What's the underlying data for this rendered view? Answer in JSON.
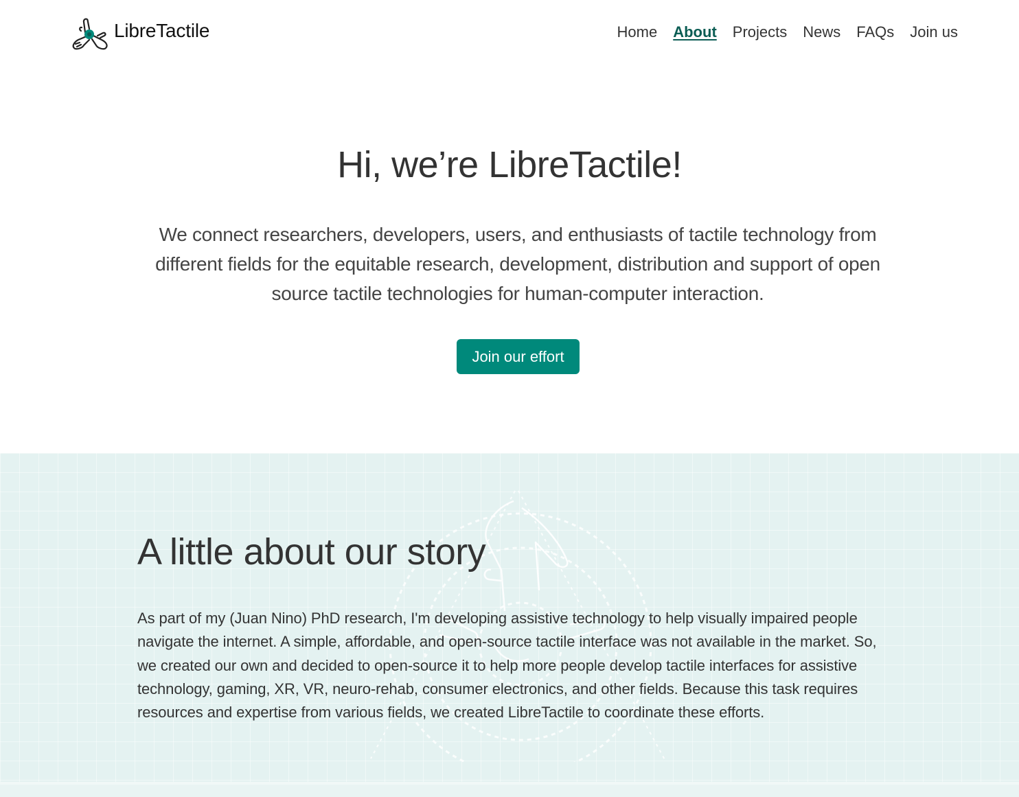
{
  "header": {
    "brand_name": "LibreTactile",
    "logo_icon": "three-hands-logo-icon",
    "nav": [
      {
        "label": "Home",
        "active": false
      },
      {
        "label": "About",
        "active": true
      },
      {
        "label": "Projects",
        "active": false
      },
      {
        "label": "News",
        "active": false
      },
      {
        "label": "FAQs",
        "active": false
      },
      {
        "label": "Join us",
        "active": false
      }
    ]
  },
  "hero": {
    "title": "Hi, we’re LibreTactile!",
    "text": "We connect researchers, developers, users, and enthusiasts of tactile technology from different fields for the equitable research, development, distribution and support of open source tactile technologies for human-computer interaction.",
    "cta_label": "Join our effort"
  },
  "story": {
    "title": "A little about our story",
    "text": "As part of my (Juan Nino) PhD research, I'm developing assistive technology to help visually impaired people navigate the internet. A simple, affordable, and open-source tactile interface was not available in the market. So, we created our own and decided to open-source it to help more people develop tactile interfaces for assistive technology, gaming, XR, VR, neuro-rehab, consumer electronics, and other fields. Because this task requires resources and expertise from various fields, we created LibreTactile to coordinate these efforts.",
    "watermark_icon": "hands-blueprint-watermark-icon"
  },
  "colors": {
    "accent": "#00897b",
    "accent_dark": "#0b5d54",
    "story_background": "#e4f2f1",
    "text": "#333333"
  }
}
